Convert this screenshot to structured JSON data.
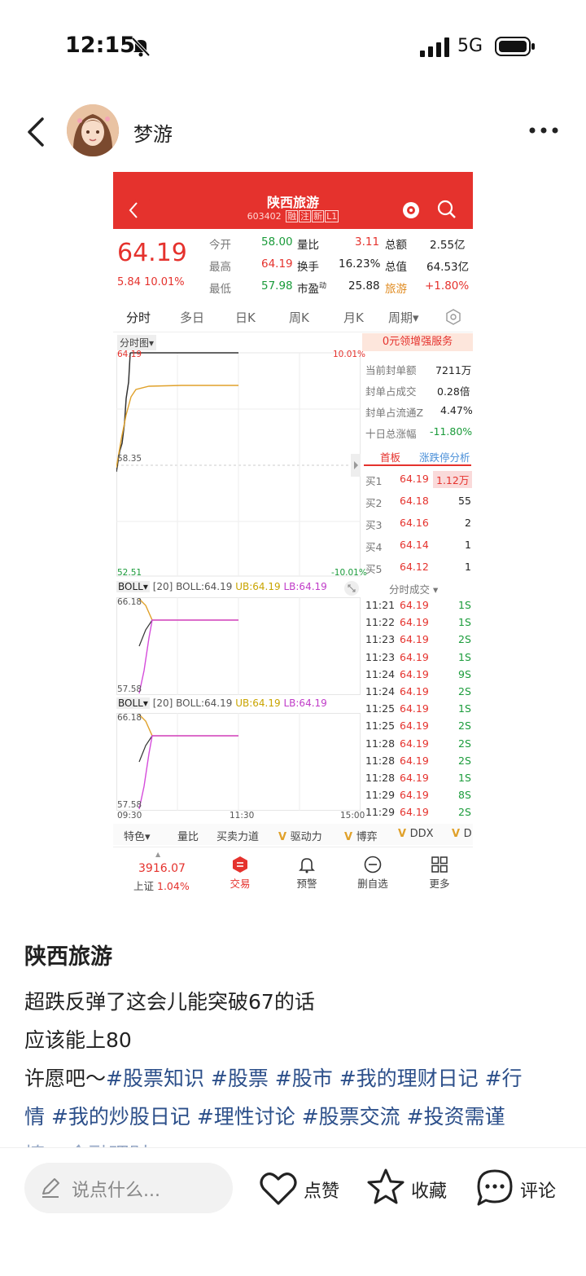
{
  "status": {
    "time": "12:15",
    "network": "5G"
  },
  "post": {
    "author": "梦游",
    "title": "陕西旅游",
    "lines": [
      "超跌反弹了这会儿能突破67的话",
      "应该能上80"
    ],
    "line3_prefix": "许愿吧～",
    "line3_tags": "#股票知识 #股票 #股市 #我的理财日记 #行",
    "line4_tags": "情 #我的炒股日记 #理性讨论 #股票交流 #投资需谨",
    "line5_partial": "慎 #金融理财"
  },
  "bottom": {
    "input_placeholder": "说点什么...",
    "like": "点赞",
    "fav": "收藏",
    "comment": "评论"
  },
  "stock": {
    "name": "陕西旅游",
    "code": "603402",
    "badges": [
      "融",
      "注",
      "新",
      "L1"
    ],
    "price": "64.19",
    "change": "5.84",
    "change_pct": "10.01%",
    "quote_rows": [
      [
        "今开",
        "58.00",
        "量比",
        "3.11",
        "总额",
        "2.55亿"
      ],
      [
        "最高",
        "64.19",
        "换手",
        "16.23%",
        "总值",
        "64.53亿"
      ],
      [
        "最低",
        "57.98",
        "市盈",
        "25.88",
        "旅游",
        "+1.80%"
      ]
    ],
    "pe_sup": "动",
    "tabs": [
      "分时",
      "多日",
      "日K",
      "周K",
      "月K",
      "周期"
    ],
    "chart_label": "分时图",
    "top_price": "64.19",
    "top_pct": "10.01%",
    "mid_price": "58.35",
    "low_price": "52.51",
    "low_pct": "-10.01%",
    "boll_label": "BOLL",
    "boll_params": "[20] BOLL:64.19",
    "boll_ub": "UB:64.19",
    "boll_lb": "LB:64.19",
    "boll_hi": "66.18",
    "boll_lo": "57.58",
    "time_start": "09:30",
    "time_mid": "11:30",
    "time_end": "15:00",
    "indicators": [
      "特色",
      "量比",
      "买卖力道",
      "驱动力",
      "博弈",
      "DDX",
      "D"
    ],
    "promo": "0元领增强服务",
    "info_rows": [
      [
        "当前封单额",
        "7211万"
      ],
      [
        "封单占成交",
        "0.28倍"
      ],
      [
        "封单占流通Z",
        "4.47%"
      ],
      [
        "十日总涨幅",
        "-11.80%"
      ]
    ],
    "board_tabs": [
      "首板",
      "涨跌停分析"
    ],
    "bids": [
      [
        "买1",
        "64.19",
        "1.12万"
      ],
      [
        "买2",
        "64.18",
        "55"
      ],
      [
        "买3",
        "64.16",
        "2"
      ],
      [
        "买4",
        "64.14",
        "1"
      ],
      [
        "买5",
        "64.12",
        "1"
      ]
    ],
    "trades_title": "分时成交",
    "trades": [
      [
        "11:21",
        "64.19",
        "1S"
      ],
      [
        "11:22",
        "64.19",
        "1S"
      ],
      [
        "11:23",
        "64.19",
        "2S"
      ],
      [
        "11:23",
        "64.19",
        "1S"
      ],
      [
        "11:24",
        "64.19",
        "9S"
      ],
      [
        "11:24",
        "64.19",
        "2S"
      ],
      [
        "11:25",
        "64.19",
        "1S"
      ],
      [
        "11:25",
        "64.19",
        "2S"
      ],
      [
        "11:28",
        "64.19",
        "2S"
      ],
      [
        "11:28",
        "64.19",
        "2S"
      ],
      [
        "11:28",
        "64.19",
        "1S"
      ],
      [
        "11:29",
        "64.19",
        "8S"
      ],
      [
        "11:29",
        "64.19",
        "2S"
      ]
    ],
    "nav": {
      "index_value": "3916.07",
      "index_name": "上证",
      "index_pct": "1.04%",
      "trade": "交易",
      "alert": "预警",
      "del": "删自选",
      "more": "更多"
    }
  }
}
